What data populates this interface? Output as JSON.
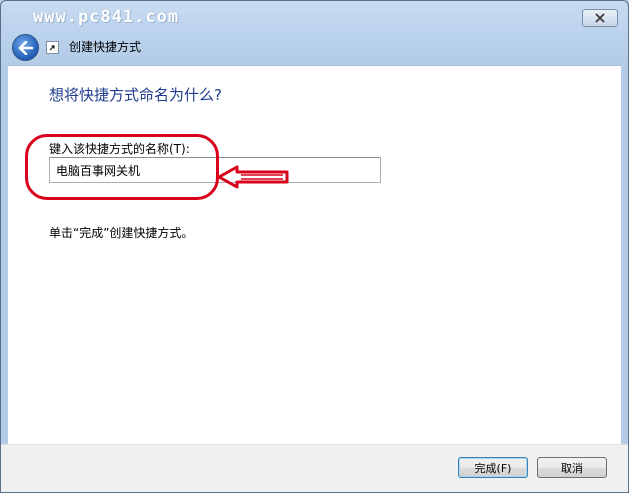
{
  "watermark": "www.pc841.com",
  "titlebar": {
    "title": "创建快捷方式"
  },
  "main": {
    "heading": "想将快捷方式命名为什么?",
    "field_label": "键入该快捷方式的名称(T):",
    "field_value": "电脑百事网关机",
    "hint": "单击“完成”创建快捷方式。"
  },
  "footer": {
    "finish_label": "完成(F)",
    "cancel_label": "取消"
  },
  "icons": [
    "close-icon",
    "back-arrow-icon",
    "shortcut-icon"
  ],
  "colors": {
    "heading": "#1f3c8c",
    "annotation": "#d9001b",
    "titlebar": "#bcd3ed"
  }
}
